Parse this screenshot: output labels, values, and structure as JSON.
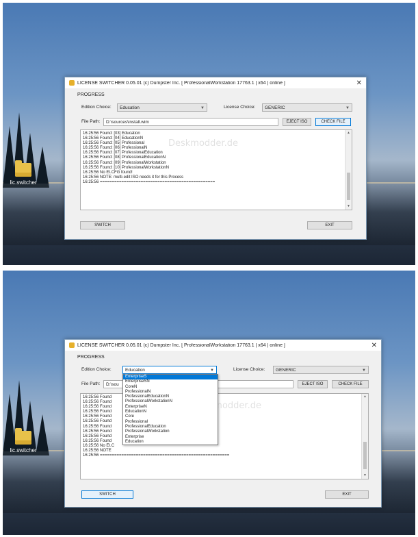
{
  "desktop": {
    "icon_label": "lic.switcher"
  },
  "window": {
    "title": "LICENSE SWITCHER 0.05.01 (c) Dumpster Inc. [ ProfessionalWorkstation 17763.1 | x64 | online ]",
    "progress_label": "PROGRESS",
    "edition_label": "Edition Choice:",
    "edition_value": "Education",
    "license_label": "License Choice:",
    "license_value": "GENERIC",
    "file_label": "File Path:",
    "file_value": "D:\\sources\\install.wim",
    "file_value_short": "D:\\sou",
    "eject_label": "EJECT ISO",
    "check_label": "CHECK FILE",
    "switch_label": "SWITCH",
    "exit_label": "EXIT",
    "watermark": "Deskmodder.de"
  },
  "log_lines": [
    "16:25:56 Found: [03] Education",
    "16:25:56 Found: [04] EducationN",
    "16:25:56 Found: [05] Professional",
    "16:25:56 Found: [06] ProfessionalN",
    "16:25:56 Found: [07] ProfessionalEducation",
    "16:25:56 Found: [08] ProfessionalEducationN",
    "16:25:56 Found: [09] ProfessionalWorkstation",
    "16:25:56 Found: [10] ProfessionalWorkstationN",
    "16:25:56 No EI.CFG found!",
    "16:25:56 NOTE: multi-edit ISO needs it for this Process",
    "16:25:56 ================================================"
  ],
  "log_lines_short": [
    "16:25:56 Found",
    "16:25:56 Found",
    "16:25:56 Found",
    "16:25:56 Found",
    "16:25:56 Found",
    "16:25:56 Found",
    "16:25:56 Found",
    "16:25:56 Found",
    "16:25:56 Found",
    "16:25:56 Found",
    "16:25:56 No EI.C",
    "16:25:56 NOTE",
    "16:25:56 ======================================================"
  ],
  "edition_options": [
    "EnterpriseS",
    "EnterpriseSN",
    "CoreN",
    "ProfessionalN",
    "ProfessionalEducationN",
    "ProfessionalWorkstationN",
    "EnterpriseN",
    "EducationN",
    "Core",
    "Professional",
    "ProfessionalEducation",
    "ProfessionalWorkstation",
    "Enterprise",
    "Education"
  ],
  "selected_option_index": 0
}
